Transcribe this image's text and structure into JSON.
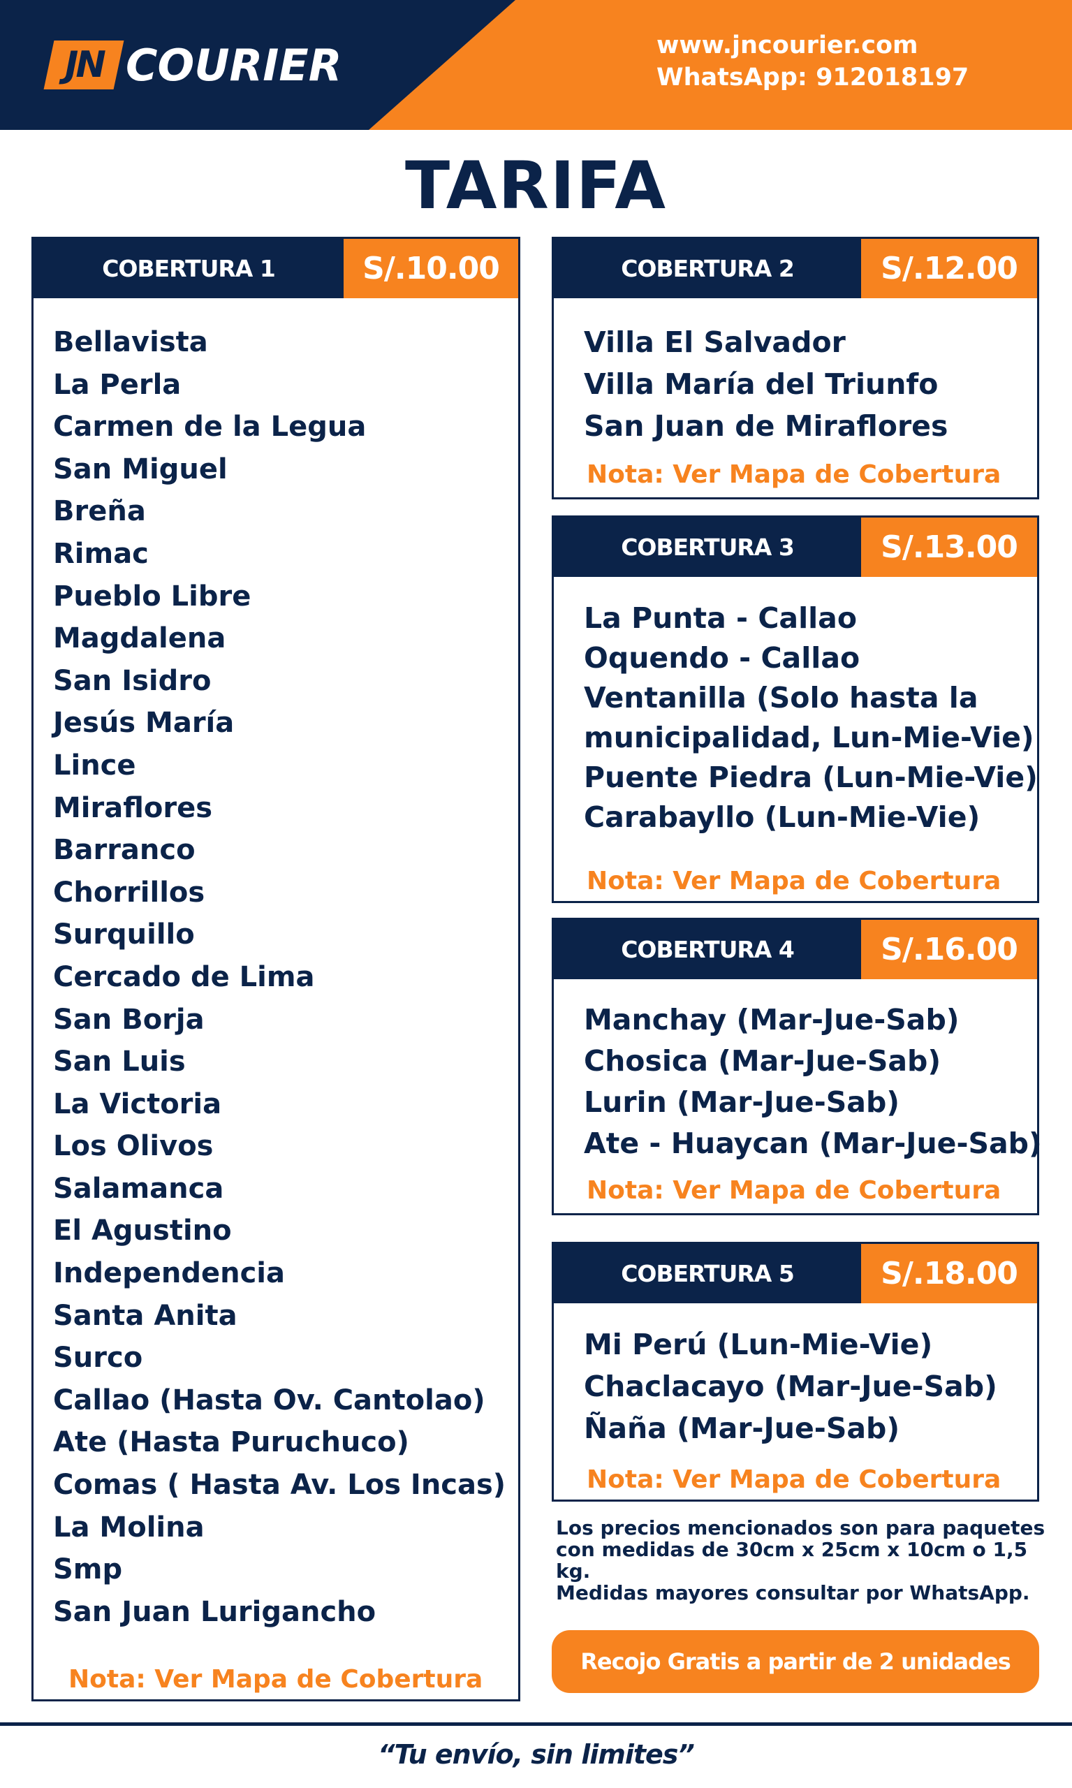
{
  "header": {
    "logo_mark": "JN",
    "logo_word": "COURIER",
    "website": "www.jncourier.com",
    "whatsapp": "WhatsApp: 912018197"
  },
  "title": "TARIFA",
  "colors": {
    "navy": "#0b2349",
    "orange": "#f7831f"
  },
  "coverages": [
    {
      "label": "COBERTURA 1",
      "price": "S/.10.00",
      "districts": [
        "Bellavista",
        "La Perla",
        "Carmen de la Legua",
        "San Miguel",
        "Breña",
        "Rimac",
        "Pueblo Libre",
        "Magdalena",
        "San Isidro",
        "Jesús María",
        "Lince",
        "Miraflores",
        "Barranco",
        "Chorrillos",
        "Surquillo",
        "Cercado de Lima",
        "San Borja",
        "San Luis",
        "La Victoria",
        "Los Olivos",
        "Salamanca",
        "El Agustino",
        "Independencia",
        "Santa Anita",
        "Surco",
        "Callao (Hasta Ov. Cantolao)",
        "Ate (Hasta Puruchuco)",
        "Comas ( Hasta Av. Los Incas)",
        "La Molina",
        "Smp",
        "San Juan Lurigancho"
      ],
      "note": "Nota: Ver Mapa de Cobertura"
    },
    {
      "label": "COBERTURA 2",
      "price": "S/.12.00",
      "districts": [
        "Villa El Salvador",
        "Villa María del Triunfo",
        "San Juan de Miraflores"
      ],
      "note": "Nota: Ver Mapa de Cobertura"
    },
    {
      "label": "COBERTURA 3",
      "price": "S/.13.00",
      "districts": [
        "La Punta - Callao",
        "Oquendo - Callao",
        "Ventanilla (Solo hasta la",
        "municipalidad, Lun-Mie-Vie)",
        "Puente Piedra (Lun-Mie-Vie)",
        "Carabayllo (Lun-Mie-Vie)"
      ],
      "note": "Nota: Ver Mapa de Cobertura"
    },
    {
      "label": "COBERTURA 4",
      "price": "S/.16.00",
      "districts": [
        "Manchay (Mar-Jue-Sab)",
        "Chosica (Mar-Jue-Sab)",
        "Lurin (Mar-Jue-Sab)",
        "Ate - Huaycan (Mar-Jue-Sab)"
      ],
      "note": "Nota: Ver Mapa de Cobertura"
    },
    {
      "label": "COBERTURA 5",
      "price": "S/.18.00",
      "districts": [
        "Mi Perú (Lun-Mie-Vie)",
        "Chaclacayo (Mar-Jue-Sab)",
        "Ñaña (Mar-Jue-Sab)"
      ],
      "note": "Nota: Ver Mapa de Cobertura"
    }
  ],
  "disclaimer": [
    "Los precios mencionados son para paquetes",
    "con medidas de 30cm x 25cm x 10cm o 1,5 kg.",
    "Medidas mayores consultar por WhatsApp."
  ],
  "pickup_button": "Recojo Gratis a partir de 2 unidades",
  "slogan": "“Tu envío, sin limites”"
}
